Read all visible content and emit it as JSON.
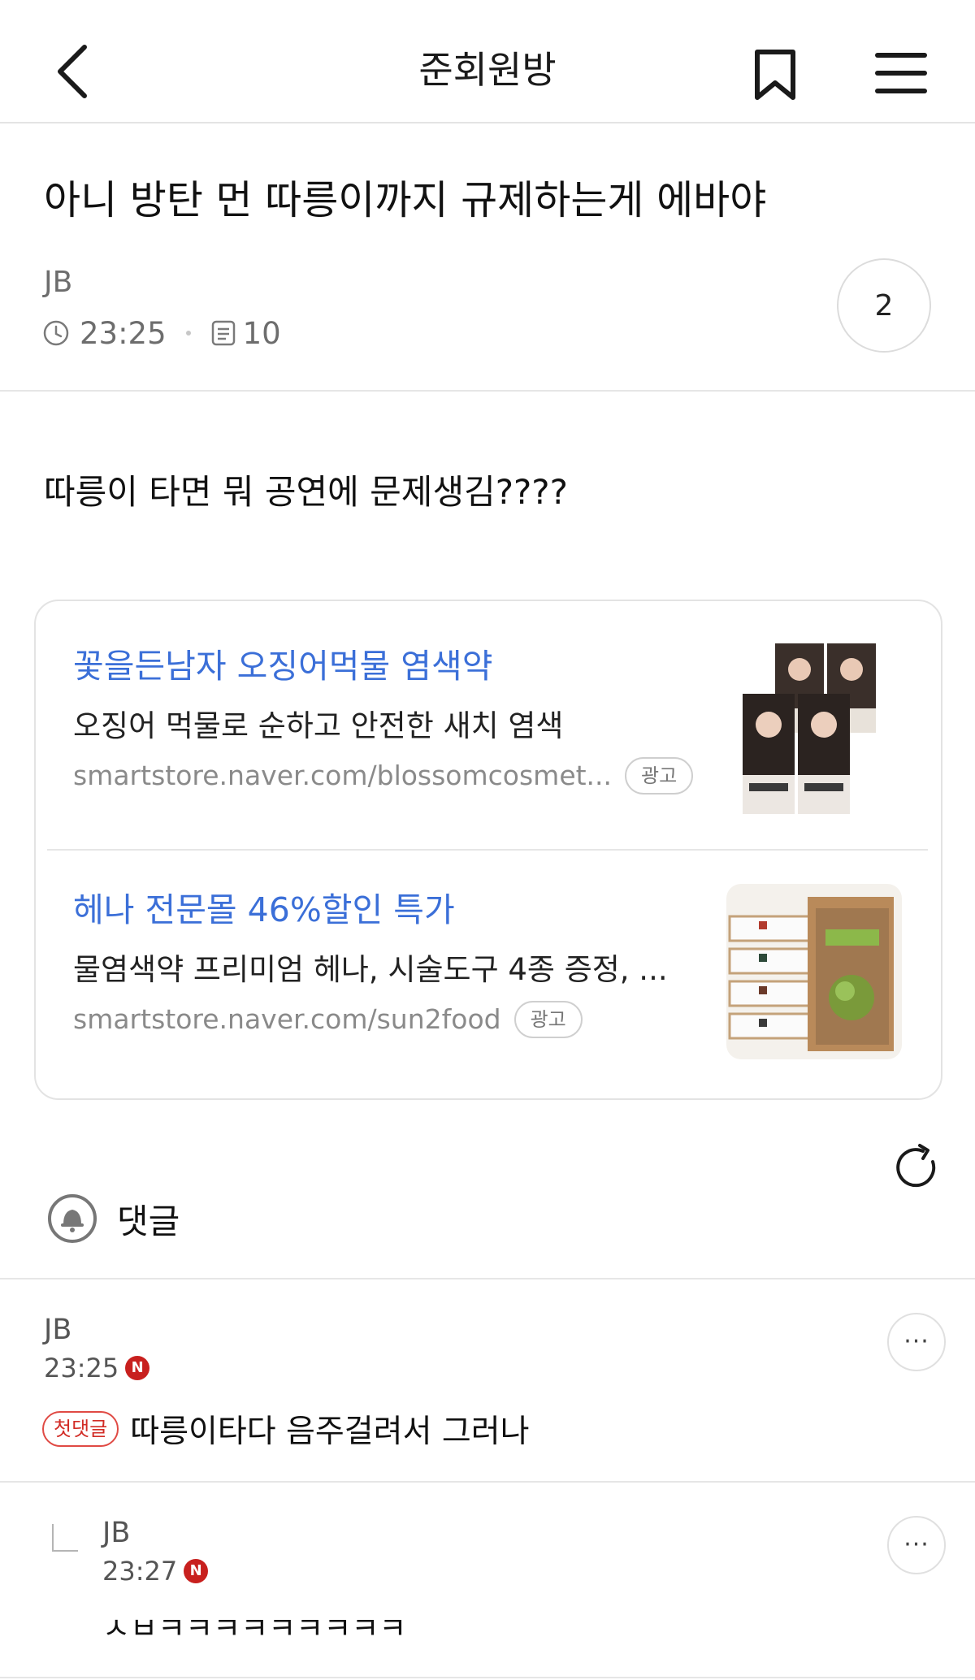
{
  "header": {
    "title": "준회원방",
    "back_icon": "chevron-left-icon",
    "bookmark_icon": "bookmark-icon",
    "menu_icon": "hamburger-menu-icon"
  },
  "post": {
    "title": "아니 방탄 먼 따릉이까지 규제하는게 에바야",
    "author": "JB",
    "time": "23:25",
    "views": "10",
    "comment_count": "2",
    "body": "따릉이 타면 뭐 공연에 문제생김????"
  },
  "ads": [
    {
      "title": "꽃을든남자 오징어먹물 염색약",
      "description": "오징어 먹물로 순하고 안전한 새치 염색",
      "url": "smartstore.naver.com/blossomcosmet...",
      "badge": "광고"
    },
    {
      "title": "헤나 전문몰 46%할인 특가",
      "description": "물염색약 프리미엄 헤나, 시술도구 4종 증정, ...",
      "url": "smartstore.naver.com/sun2food",
      "badge": "광고"
    }
  ],
  "comments_section": {
    "label": "댓글",
    "refresh_icon": "refresh-icon"
  },
  "comments": [
    {
      "author": "JB",
      "time": "23:25",
      "n_badge": "N",
      "first_badge": "첫댓글",
      "text": "따릉이타다 음주걸려서 그러나",
      "more": "···"
    },
    {
      "author": "JB",
      "time": "23:27",
      "n_badge": "N",
      "text": "ㅅㅂㅋㅋㅋㅋㅋㅋㅋㅋㅋ",
      "more": "···"
    }
  ],
  "colors": {
    "ad_title": "#3b6fd8",
    "n_badge": "#c8201e",
    "first_badge": "#d22c26",
    "divider": "#e6e6e6"
  }
}
